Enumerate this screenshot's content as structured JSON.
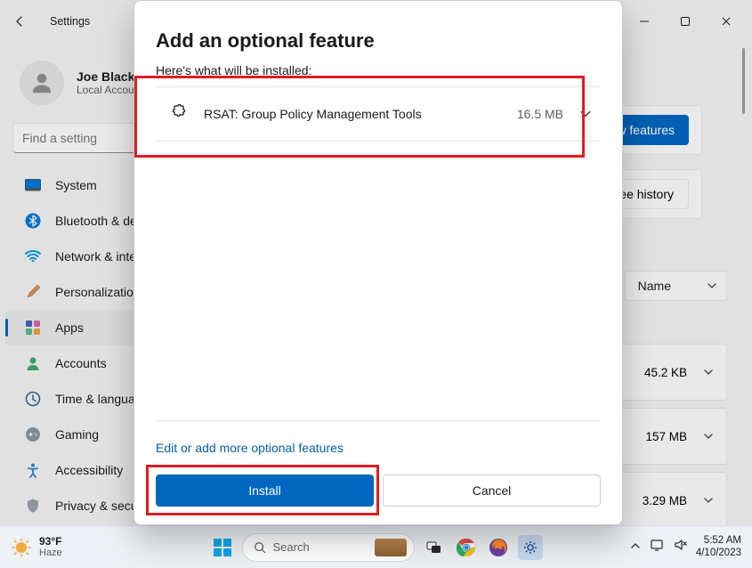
{
  "window": {
    "title": "Settings"
  },
  "profile": {
    "name": "Joe Black",
    "subtitle": "Local Account"
  },
  "search": {
    "placeholder": "Find a setting"
  },
  "nav": {
    "items": [
      {
        "label": "System",
        "icon": "system"
      },
      {
        "label": "Bluetooth & devices",
        "icon": "bluetooth"
      },
      {
        "label": "Network & internet",
        "icon": "wifi"
      },
      {
        "label": "Personalization",
        "icon": "personalization"
      },
      {
        "label": "Apps",
        "icon": "apps"
      },
      {
        "label": "Accounts",
        "icon": "accounts"
      },
      {
        "label": "Time & language",
        "icon": "time"
      },
      {
        "label": "Gaming",
        "icon": "gaming"
      },
      {
        "label": "Accessibility",
        "icon": "accessibility"
      },
      {
        "label": "Privacy & security",
        "icon": "privacy"
      }
    ],
    "selected_index": 4
  },
  "background_buttons": {
    "view_features": "View features",
    "see_history": "See history",
    "sort_label": "Name"
  },
  "background_rows": [
    {
      "size": "45.2 KB"
    },
    {
      "size": "157 MB"
    },
    {
      "size": "3.29 MB"
    }
  ],
  "dialog": {
    "title": "Add an optional feature",
    "subtitle": "Here's what will be installed:",
    "feature": {
      "name": "RSAT: Group Policy Management Tools",
      "size": "16.5 MB"
    },
    "edit_link": "Edit or add more optional features",
    "install": "Install",
    "cancel": "Cancel"
  },
  "taskbar": {
    "weather": {
      "temp": "93°F",
      "condition": "Haze"
    },
    "search_placeholder": "Search",
    "time": "5:52 AM",
    "date": "4/10/2023"
  }
}
